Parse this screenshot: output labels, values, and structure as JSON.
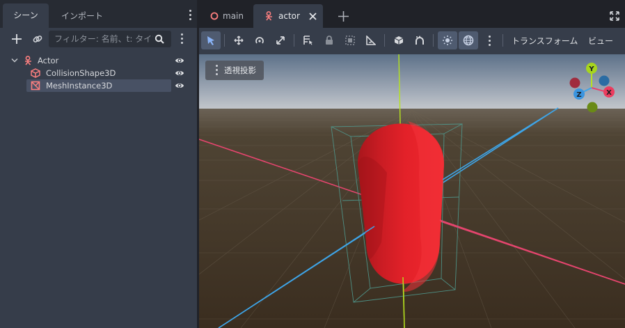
{
  "dock": {
    "tabs": [
      {
        "label": "シーン",
        "active": true
      },
      {
        "label": "インポート",
        "active": false
      }
    ],
    "filter_placeholder": "フィルター: 名前、t: タイプ",
    "tree": [
      {
        "label": "Actor",
        "icon": "actor-icon",
        "color": "#fc7f7f",
        "depth": 0,
        "expanded": true
      },
      {
        "label": "CollisionShape3D",
        "icon": "collision-shape-icon",
        "color": "#fc7f7f",
        "depth": 1
      },
      {
        "label": "MeshInstance3D",
        "icon": "mesh-instance-icon",
        "color": "#fc7f7f",
        "depth": 1,
        "selected": true
      }
    ]
  },
  "editor": {
    "tabs": [
      {
        "label": "main",
        "icon": "ring-icon",
        "active": false
      },
      {
        "label": "actor",
        "icon": "actor-icon",
        "active": true
      }
    ],
    "menus": {
      "transform": "トランスフォーム",
      "view": "ビュー"
    },
    "viewport": {
      "perspective_label": "透視投影",
      "gizmo": {
        "x": "X",
        "y": "Y",
        "z": "Z"
      }
    }
  },
  "colors": {
    "accent": "#fc7f7f",
    "capsule": "#e8232b",
    "x_axis": "#e5456e",
    "y_axis": "#b6e31e",
    "z_axis": "#3ea5e8"
  }
}
